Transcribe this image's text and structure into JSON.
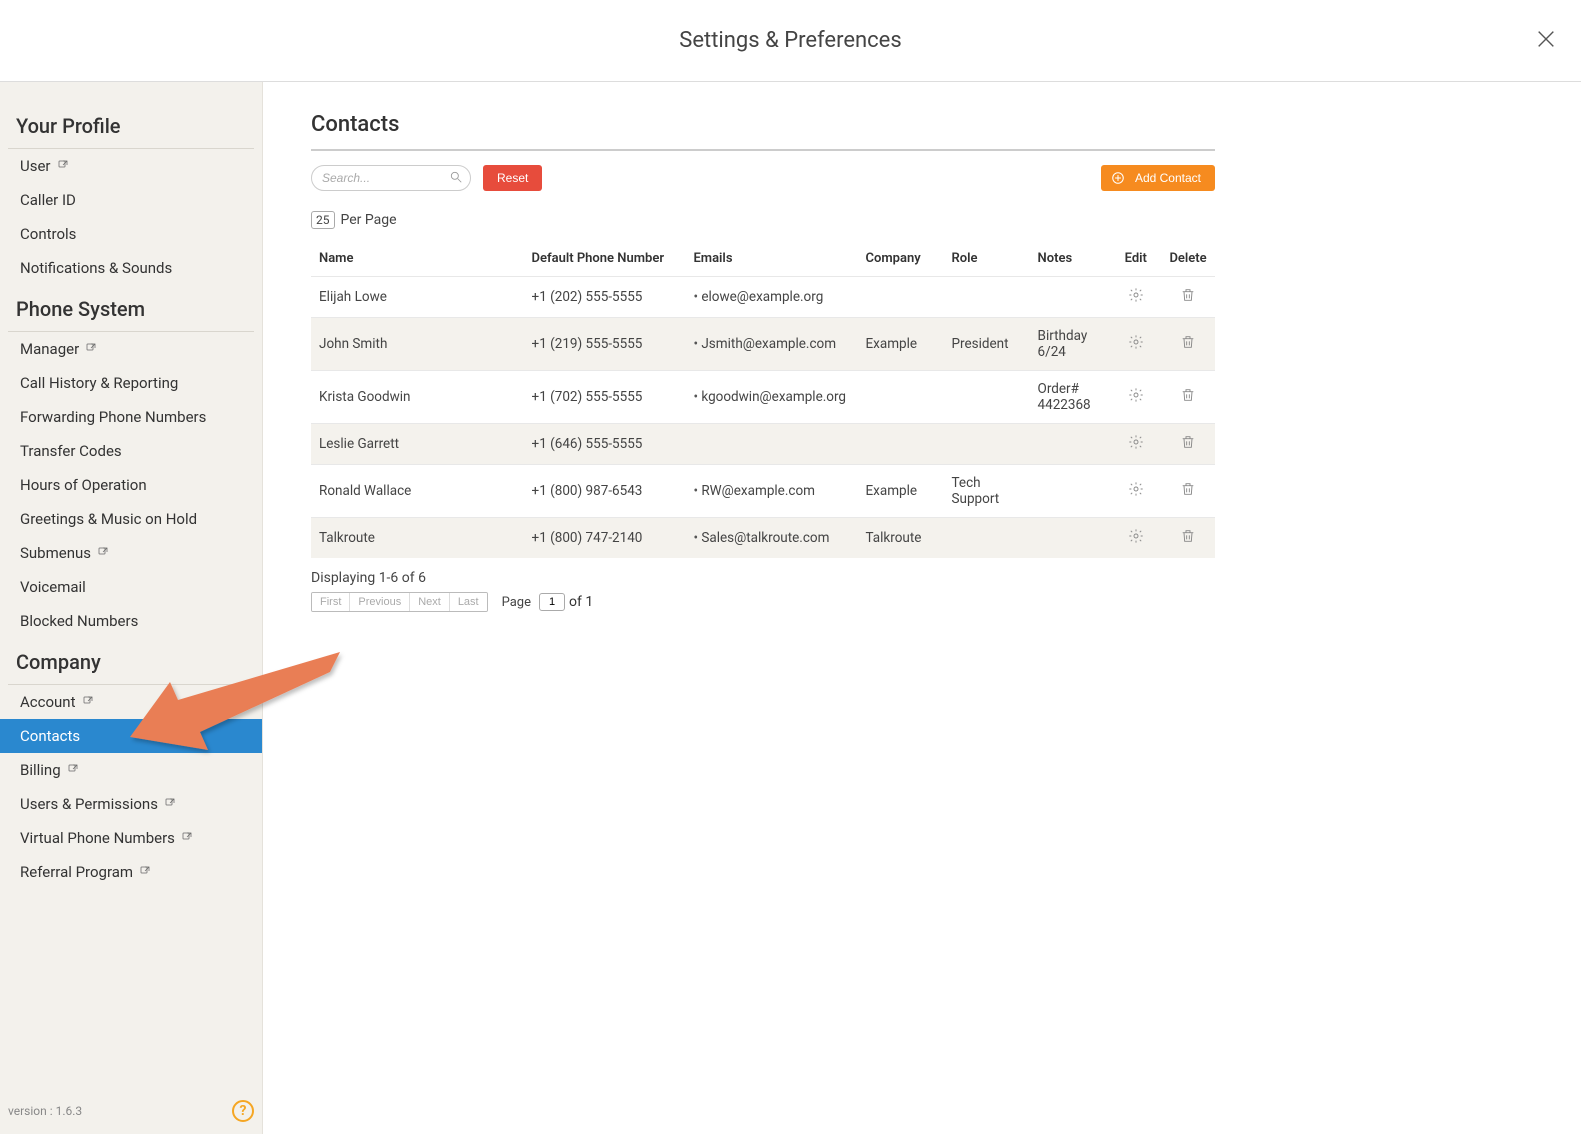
{
  "header": {
    "title": "Settings & Preferences"
  },
  "sidebar": {
    "sections": [
      {
        "title": "Your Profile",
        "items": [
          {
            "label": "User",
            "ext": true
          },
          {
            "label": "Caller ID"
          },
          {
            "label": "Controls"
          },
          {
            "label": "Notifications & Sounds"
          }
        ]
      },
      {
        "title": "Phone System",
        "items": [
          {
            "label": "Manager",
            "ext": true
          },
          {
            "label": "Call History & Reporting"
          },
          {
            "label": "Forwarding Phone Numbers"
          },
          {
            "label": "Transfer Codes"
          },
          {
            "label": "Hours of Operation"
          },
          {
            "label": "Greetings & Music on Hold"
          },
          {
            "label": "Submenus",
            "ext": true
          },
          {
            "label": "Voicemail"
          },
          {
            "label": "Blocked Numbers"
          }
        ]
      },
      {
        "title": "Company",
        "items": [
          {
            "label": "Account",
            "ext": true
          },
          {
            "label": "Contacts",
            "active": true
          },
          {
            "label": "Billing",
            "ext": true
          },
          {
            "label": "Users & Permissions",
            "ext": true
          },
          {
            "label": "Virtual Phone Numbers",
            "ext": true
          },
          {
            "label": "Referral Program",
            "ext": true
          }
        ]
      }
    ],
    "version": "version : 1.6.3"
  },
  "main": {
    "title": "Contacts",
    "search_placeholder": "Search...",
    "reset_label": "Reset",
    "add_label": "Add Contact",
    "per_page_value": "25",
    "per_page_label": "Per Page",
    "columns": {
      "name": "Name",
      "phone": "Default Phone Number",
      "emails": "Emails",
      "company": "Company",
      "role": "Role",
      "notes": "Notes",
      "edit": "Edit",
      "delete": "Delete"
    },
    "rows": [
      {
        "name": "Elijah Lowe",
        "phone": "+1 (202) 555-5555",
        "email": "elowe@example.org",
        "company": "",
        "role": "",
        "notes": ""
      },
      {
        "name": "John Smith",
        "phone": "+1 (219) 555-5555",
        "email": "Jsmith@example.com",
        "company": "Example",
        "role": "President",
        "notes": "Birthday 6/24"
      },
      {
        "name": "Krista Goodwin",
        "phone": "+1 (702) 555-5555",
        "email": "kgoodwin@example.org",
        "company": "",
        "role": "",
        "notes": "Order# 4422368"
      },
      {
        "name": "Leslie Garrett",
        "phone": "+1 (646) 555-5555",
        "email": "",
        "company": "",
        "role": "",
        "notes": ""
      },
      {
        "name": "Ronald Wallace",
        "phone": "+1 (800) 987-6543",
        "email": "RW@example.com",
        "company": "Example",
        "role": "Tech Support",
        "notes": ""
      },
      {
        "name": "Talkroute",
        "phone": "+1 (800) 747-2140",
        "email": "Sales@talkroute.com",
        "company": "Talkroute",
        "role": "",
        "notes": ""
      }
    ],
    "result_count": "Displaying 1-6 of 6",
    "pager": {
      "first": "First",
      "previous": "Previous",
      "next": "Next",
      "last": "Last",
      "page_label": "Page",
      "page_value": "1",
      "of_label": "of 1"
    }
  }
}
